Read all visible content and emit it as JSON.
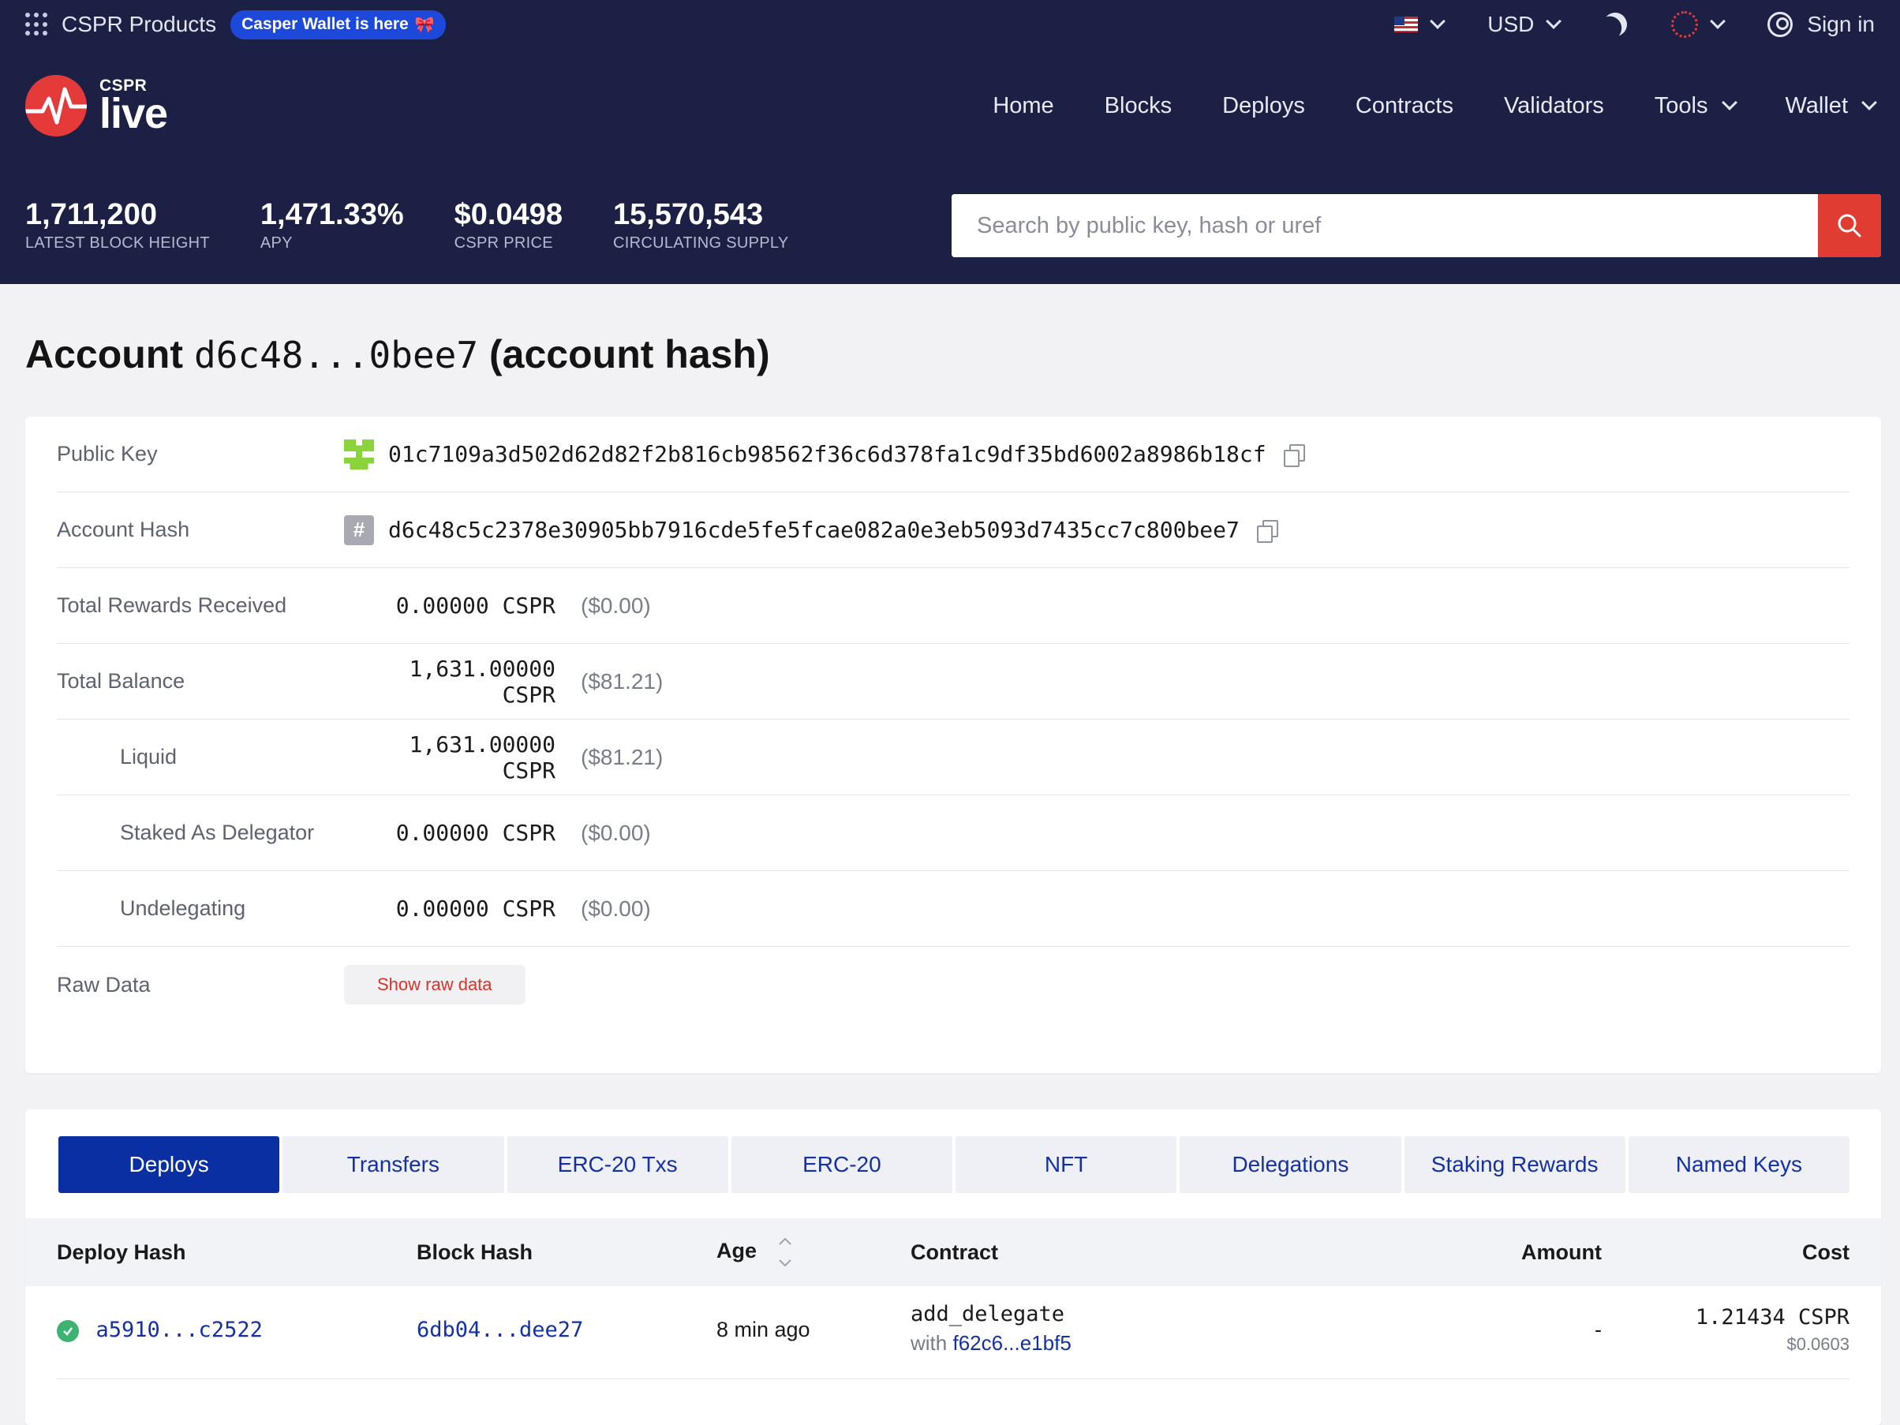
{
  "topbar": {
    "products_label": "CSPR Products",
    "promo_badge": "Casper Wallet is here",
    "currency": "USD",
    "sign_in": "Sign in"
  },
  "logo": {
    "small": "CSPR",
    "big": "live"
  },
  "nav": [
    "Home",
    "Blocks",
    "Deploys",
    "Contracts",
    "Validators",
    "Tools",
    "Wallet"
  ],
  "stats": [
    {
      "value": "1,711,200",
      "label": "LATEST BLOCK HEIGHT"
    },
    {
      "value": "1,471.33%",
      "label": "APY"
    },
    {
      "value": "$0.0498",
      "label": "CSPR PRICE"
    },
    {
      "value": "15,570,543",
      "label": "CIRCULATING SUPPLY"
    }
  ],
  "search": {
    "placeholder": "Search by public key, hash or uref"
  },
  "title": {
    "prefix": "Account",
    "hash": "d6c48...0bee7",
    "suffix": "(account hash)"
  },
  "details": {
    "public_key_label": "Public Key",
    "public_key": "01c7109a3d502d62d82f2b816cb98562f36c6d378fa1c9df35bd6002a8986b18cf",
    "account_hash_label": "Account Hash",
    "account_hash": "d6c48c5c2378e30905bb7916cde5fe5fcae082a0e3eb5093d7435cc7c800bee7",
    "rewards_label": "Total Rewards Received",
    "rewards_amount": "0.00000 CSPR",
    "rewards_usd": "($0.00)",
    "balance_label": "Total Balance",
    "balance_amount": "1,631.00000 CSPR",
    "balance_usd": "($81.21)",
    "liquid_label": "Liquid",
    "liquid_amount": "1,631.00000 CSPR",
    "liquid_usd": "($81.21)",
    "staked_label": "Staked As Delegator",
    "staked_amount": "0.00000 CSPR",
    "staked_usd": "($0.00)",
    "undelegating_label": "Undelegating",
    "undelegating_amount": "0.00000 CSPR",
    "undelegating_usd": "($0.00)",
    "raw_label": "Raw Data",
    "raw_button": "Show raw data"
  },
  "tabs": [
    "Deploys",
    "Transfers",
    "ERC-20 Txs",
    "ERC-20",
    "NFT",
    "Delegations",
    "Staking Rewards",
    "Named Keys"
  ],
  "table": {
    "headers": {
      "deploy_hash": "Deploy Hash",
      "block_hash": "Block Hash",
      "age": "Age",
      "contract": "Contract",
      "amount": "Amount",
      "cost": "Cost"
    },
    "rows": [
      {
        "deploy_hash": "a5910...c2522",
        "block_hash": "6db04...dee27",
        "age": "8 min ago",
        "contract": "add_delegate",
        "contract_with": "with",
        "contract_hash": "f62c6...e1bf5",
        "amount": "-",
        "cost": "1.21434 CSPR",
        "cost_usd": "$0.0603"
      }
    ]
  },
  "colors": {
    "header_bg": "#1b2044",
    "accent_red": "#e03c31",
    "tab_active": "#0a2fa3",
    "link": "#1431a3",
    "success": "#3cb371"
  }
}
